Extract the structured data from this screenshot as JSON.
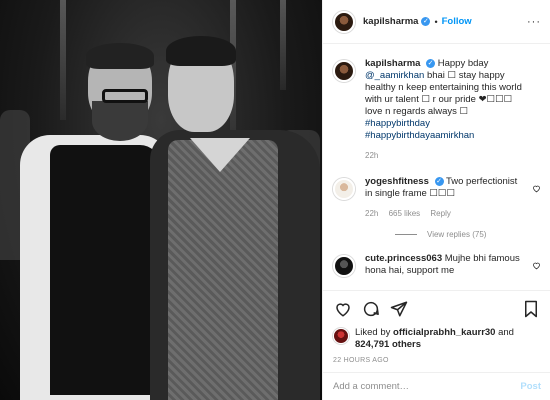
{
  "header": {
    "username": "kapilsharma",
    "verified_mark": "✓",
    "separator": "•",
    "follow_label": "Follow",
    "more_label": "···"
  },
  "caption": {
    "username": "kapilsharma",
    "text_before": "Happy bday",
    "mention": "@_aamirkhan",
    "text_after": "bhai ☐ stay happy healthy n keep entertaining this world with ur talent ☐ r our pride ❤☐☐☐ love n regards always ☐",
    "hashtags": [
      "#happybirthday",
      "#happybirthdayaamirkhan"
    ],
    "time": "22h"
  },
  "comments": [
    {
      "username": "yogeshfitness",
      "verified": true,
      "text": "Two perfectionist in single frame ☐☐☐",
      "time": "22h",
      "likes": "665 likes",
      "reply_label": "Reply",
      "view_replies": "View replies (75)"
    },
    {
      "username": "cute.princess063",
      "verified": false,
      "text": "Mujhe bhi famous hona hai, support me"
    }
  ],
  "likes": {
    "prefix": "Liked by",
    "user": "officialprabhh_kaurr30",
    "and": "and",
    "count": "824,791 others"
  },
  "timestamp": "22 HOURS AGO",
  "add_comment": {
    "placeholder": "Add a comment…",
    "post_label": "Post"
  },
  "icons": [
    "heart-icon",
    "comment-icon",
    "share-icon",
    "bookmark-icon",
    "more-icon"
  ],
  "colors": {
    "link": "#0095f6",
    "mention": "#00376b",
    "muted": "#8e8e8e",
    "verified": "#3897f0"
  }
}
